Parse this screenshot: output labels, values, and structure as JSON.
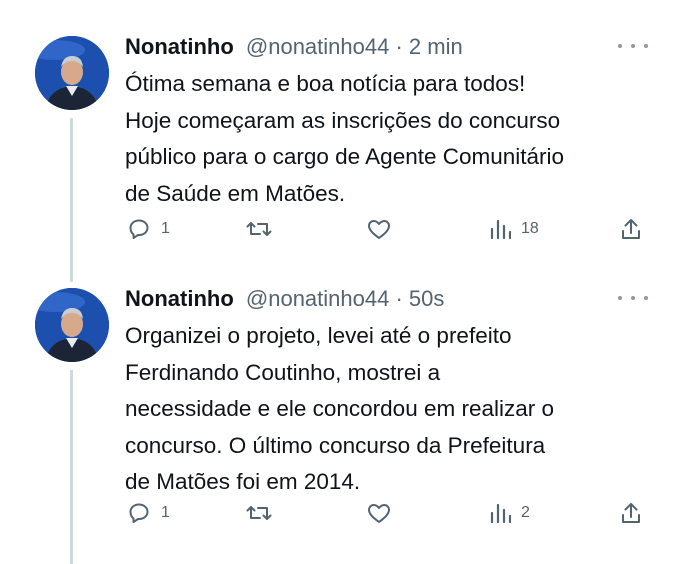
{
  "tweets": [
    {
      "display_name": "Nonatinho",
      "handle": "@nonatinho44",
      "separator": "·",
      "time": "2 min",
      "text": "Ótima semana e boa notícia para todos!\nHoje começaram as inscrições do concurso\npúblico para o cargo de Agente Comunitário\nde Saúde em Matões.",
      "replies": "1",
      "views": "18"
    },
    {
      "display_name": "Nonatinho",
      "handle": "@nonatinho44",
      "separator": "·",
      "time": "50s",
      "text": "Organizei o projeto, levei até o prefeito\nFerdinando Coutinho, mostrei a\nnecessidade e ele concordou em realizar o\nconcurso.  O último concurso da Prefeitura\nde Matões foi em 2014.",
      "replies": "1",
      "views": "2"
    }
  ],
  "icons": {
    "reply": "reply-icon",
    "retweet": "retweet-icon",
    "like": "heart-icon",
    "views": "views-icon",
    "share": "share-icon",
    "more": "more-icon"
  },
  "colors": {
    "text": "#0f1419",
    "secondary": "#536471",
    "thread_line": "#cfd9de",
    "avatar_bg": "#1d4fae"
  }
}
